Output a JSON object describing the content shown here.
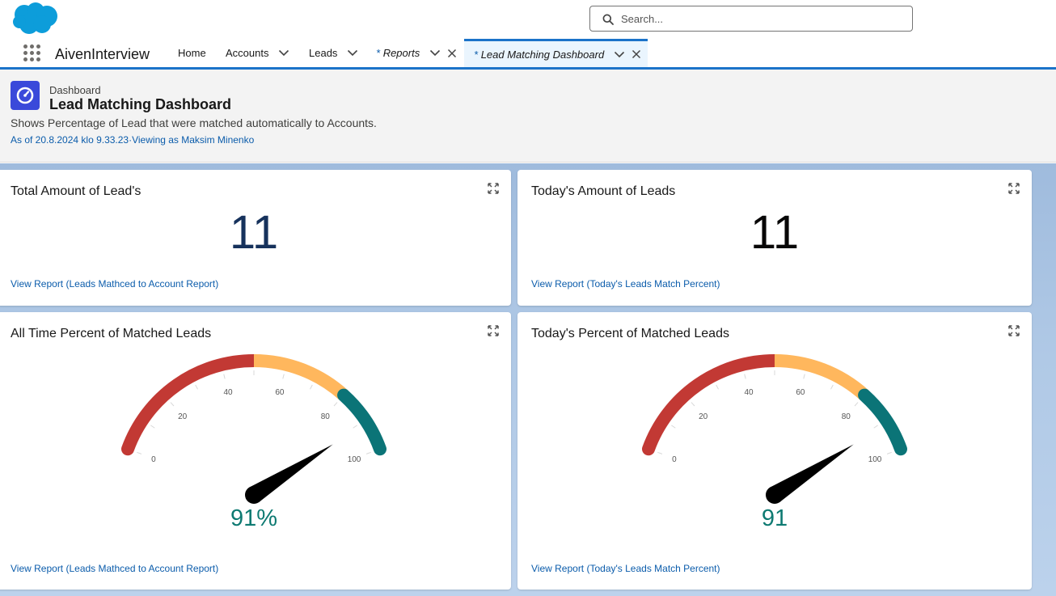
{
  "global_header": {
    "logo_icon": "salesforce-cloud-icon",
    "search_placeholder": "Search..."
  },
  "nav": {
    "app_name": "AivenInterview",
    "tabs": [
      {
        "label": "Home"
      },
      {
        "label": "Accounts"
      },
      {
        "label": "Leads"
      },
      {
        "star": "*",
        "label": "Reports"
      },
      {
        "star": "*",
        "label": "Lead Matching Dashboard"
      }
    ]
  },
  "page_header": {
    "object_type": "Dashboard",
    "title": "Lead Matching Dashboard",
    "description": "Shows Percentage of Lead that were matched automatically to Accounts.",
    "meta": "As of 20.8.2024 klo 9.33.23·Viewing as Maksim Minenko"
  },
  "components": [
    {
      "title": "Total Amount of Lead's",
      "value": "11",
      "value_color": "#16325c",
      "link": "View Report (Leads Mathced to Account Report)"
    },
    {
      "title": "Today's Amount of Leads",
      "value": "11",
      "value_color": "#080707",
      "link": "View Report (Today's Leads Match Percent)"
    },
    {
      "title": "All Time Percent of Matched Leads",
      "gauge_value": 91,
      "display": "91%",
      "link": "View Report (Leads Mathced to Account Report)"
    },
    {
      "title": "Today's Percent of Matched Leads",
      "gauge_value": 91,
      "display": "91",
      "link": "View Report (Today's Leads Match Percent)"
    }
  ],
  "gauge": {
    "min": 0,
    "max": 100,
    "tick_labels": [
      "0",
      "20",
      "40",
      "60",
      "80",
      "100"
    ],
    "segments": [
      {
        "from": 0,
        "to": 50,
        "color": "#c23934"
      },
      {
        "from": 50,
        "to": 80,
        "color": "#ffb75d"
      },
      {
        "from": 80,
        "to": 100,
        "color": "#0b7477"
      }
    ],
    "needle_color": "#000000"
  }
}
